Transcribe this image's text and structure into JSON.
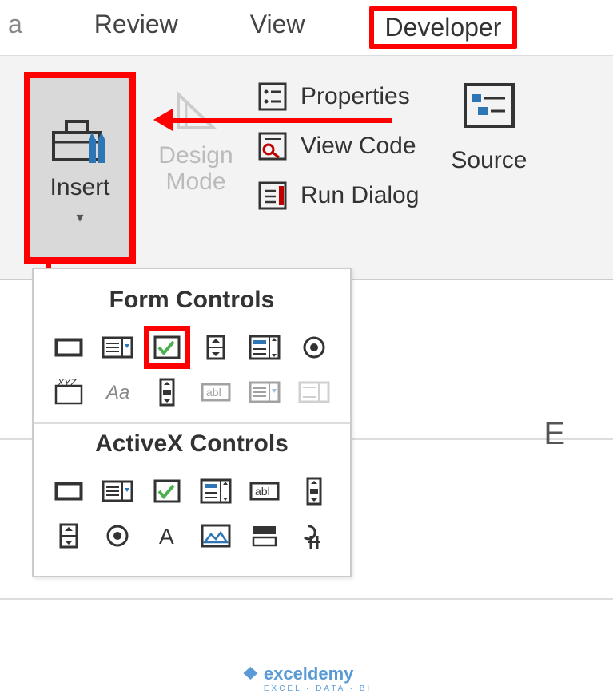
{
  "tabs": {
    "data": "a",
    "review": "Review",
    "view": "View",
    "developer": "Developer"
  },
  "ribbon": {
    "insert": "Insert",
    "design": "Design\nMode",
    "properties": "Properties",
    "viewcode": "View Code",
    "rundialog": "Run Dialog",
    "source": "Source"
  },
  "dropdown": {
    "form_title": "Form Controls",
    "activex_title": "ActiveX Controls",
    "form_items": [
      {
        "name": "button-ctrl"
      },
      {
        "name": "combo-ctrl"
      },
      {
        "name": "checkbox-ctrl",
        "highlight": true
      },
      {
        "name": "spin-ctrl"
      },
      {
        "name": "listbox-ctrl"
      },
      {
        "name": "option-ctrl"
      },
      {
        "name": "groupbox-ctrl",
        "label": "XYZ"
      },
      {
        "name": "label-ctrl",
        "label": "Aa"
      },
      {
        "name": "scrollbar-ctrl"
      },
      {
        "name": "textfield-disabled",
        "label": "abl",
        "disabled": true
      },
      {
        "name": "combo-disabled",
        "disabled": true
      },
      {
        "name": "button-disabled",
        "disabled": true
      }
    ],
    "activex_items": [
      {
        "name": "ax-button"
      },
      {
        "name": "ax-combo"
      },
      {
        "name": "ax-checkbox"
      },
      {
        "name": "ax-listbox"
      },
      {
        "name": "ax-text",
        "label": "abl"
      },
      {
        "name": "ax-scroll"
      },
      {
        "name": "ax-spin"
      },
      {
        "name": "ax-option"
      },
      {
        "name": "ax-label",
        "label": "A"
      },
      {
        "name": "ax-image"
      },
      {
        "name": "ax-toggle"
      },
      {
        "name": "ax-more"
      }
    ]
  },
  "sheet": {
    "col": "E"
  },
  "watermark": {
    "text": "exceldemy",
    "sub": "EXCEL · DATA · BI"
  }
}
